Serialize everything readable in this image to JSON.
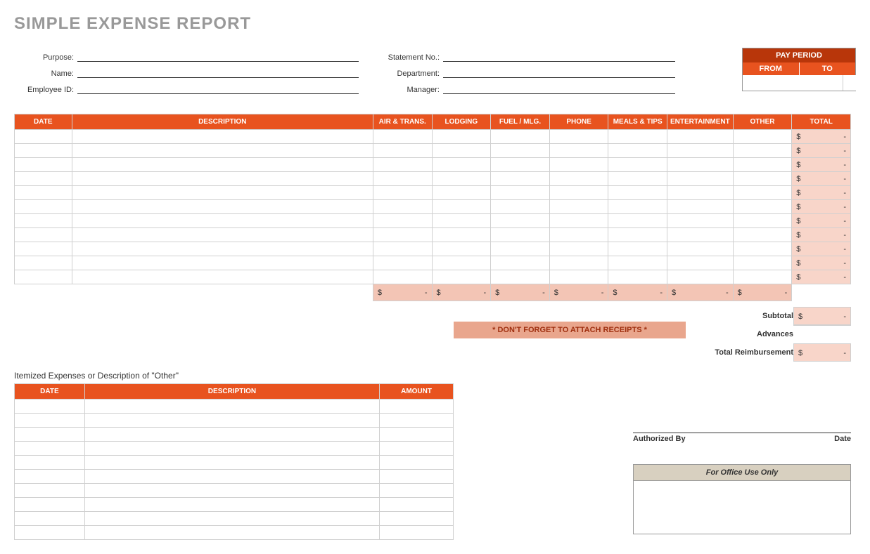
{
  "title": "SIMPLE EXPENSE REPORT",
  "header": {
    "purpose_label": "Purpose:",
    "name_label": "Name:",
    "employee_id_label": "Employee ID:",
    "statement_label": "Statement No.:",
    "department_label": "Department:",
    "manager_label": "Manager:",
    "purpose": "",
    "name": "",
    "employee_id": "",
    "statement_no": "",
    "department": "",
    "manager": ""
  },
  "pay_period": {
    "title": "PAY PERIOD",
    "from_label": "FROM",
    "to_label": "TO",
    "from": "",
    "to": ""
  },
  "main_columns": {
    "date": "DATE",
    "description": "DESCRIPTION",
    "air_trans": "AIR & TRANS.",
    "lodging": "LODGING",
    "fuel_mlg": "FUEL / MLG.",
    "phone": "PHONE",
    "meals_tips": "MEALS & TIPS",
    "entertainment": "ENTERTAINMENT",
    "other": "OTHER",
    "total": "TOTAL"
  },
  "currency": "$",
  "dash": "-",
  "main_row_count": 11,
  "receipts_note": "* DON'T FORGET TO ATTACH RECEIPTS *",
  "summary": {
    "subtotal_label": "Subtotal",
    "advances_label": "Advances",
    "total_reimb_label": "Total Reimbursement"
  },
  "itemized_label": "Itemized Expenses or Description of \"Other\"",
  "itemized_columns": {
    "date": "DATE",
    "description": "DESCRIPTION",
    "amount": "AMOUNT"
  },
  "itemized_row_count": 10,
  "auth": {
    "authorized_by": "Authorized By",
    "date": "Date"
  },
  "office_use": "For Office Use Only"
}
